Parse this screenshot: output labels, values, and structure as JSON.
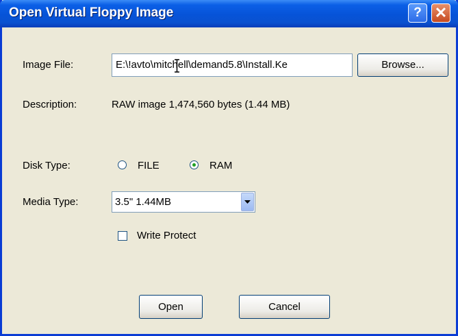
{
  "window": {
    "title": "Open Virtual Floppy Image"
  },
  "titlebar_buttons": {
    "help": "?",
    "close": "✕"
  },
  "image_file": {
    "label": "Image File:",
    "value": "E:\\!avto\\mitchell\\demand5.8\\Install.Ke",
    "browse_label": "Browse..."
  },
  "description": {
    "label": "Description:",
    "value": "RAW image 1,474,560 bytes (1.44 MB)"
  },
  "disk_type": {
    "label": "Disk Type:",
    "options": [
      "FILE",
      "RAM"
    ],
    "selected": "RAM"
  },
  "media_type": {
    "label": "Media Type:",
    "selected": "3.5\"  1.44MB"
  },
  "write_protect": {
    "label": "Write Protect",
    "checked": false
  },
  "footer": {
    "open_label": "Open",
    "cancel_label": "Cancel"
  },
  "colors": {
    "dialog_bg": "#ECE9D8",
    "titlebar": "#0653D8",
    "border": "#0A3CD4"
  },
  "icons": {
    "help": "help-icon",
    "close": "close-icon",
    "dropdown": "chevron-down-icon",
    "cursor": "text-cursor-icon"
  }
}
